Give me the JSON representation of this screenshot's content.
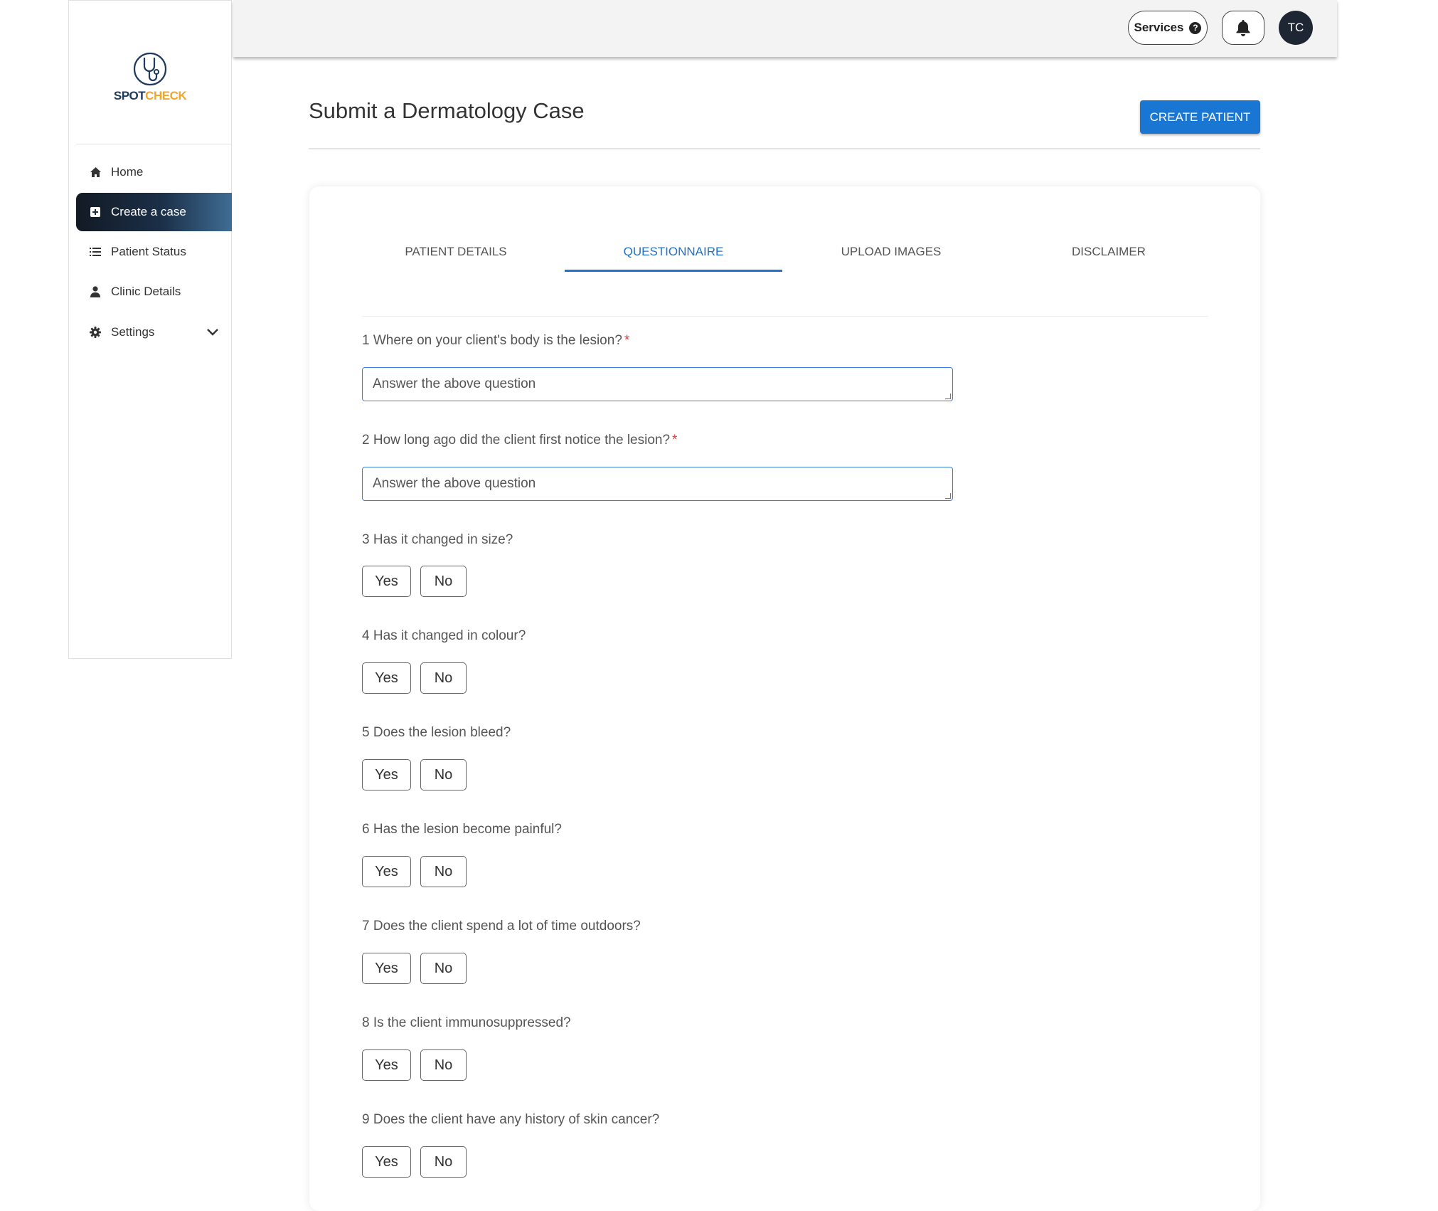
{
  "brand": {
    "name_part1": "SPOT",
    "name_part2": "CHECK",
    "color_primary": "#1f3a5c",
    "color_accent": "#f5a623"
  },
  "sidebar": {
    "items": [
      {
        "label": "Home",
        "icon": "home-icon"
      },
      {
        "label": "Create a case",
        "icon": "plus-square-icon",
        "active": true
      },
      {
        "label": "Patient Status",
        "icon": "list-icon"
      },
      {
        "label": "Clinic Details",
        "icon": "user-icon"
      },
      {
        "label": "Settings",
        "icon": "gear-icon",
        "expandable": true
      }
    ]
  },
  "topbar": {
    "services_label": "Services",
    "services_help_glyph": "?",
    "avatar_initials": "TC"
  },
  "header": {
    "title": "Submit a Dermatology Case",
    "create_patient_label": "CREATE PATIENT",
    "accent": "#1976d2"
  },
  "tabs": [
    {
      "label": "PATIENT DETAILS"
    },
    {
      "label": "QUESTIONNAIRE",
      "active": true
    },
    {
      "label": "UPLOAD IMAGES"
    },
    {
      "label": "DISCLAIMER"
    }
  ],
  "questions": [
    {
      "text": "1 Where on your client's body is the lesion?",
      "required": "*",
      "type": "text",
      "placeholder": "Answer the above question"
    },
    {
      "text": "2 How long ago did the client first notice the lesion?",
      "required": "*",
      "type": "text",
      "placeholder": "Answer the above question"
    },
    {
      "text": "3 Has it changed in size?",
      "type": "yesno"
    },
    {
      "text": "4 Has it changed in colour?",
      "type": "yesno"
    },
    {
      "text": "5 Does the lesion bleed?",
      "type": "yesno"
    },
    {
      "text": "6 Has the lesion become painful?",
      "type": "yesno"
    },
    {
      "text": "7 Does the client spend a lot of time outdoors?",
      "type": "yesno"
    },
    {
      "text": "8 Is the client immunosuppressed?",
      "type": "yesno"
    },
    {
      "text": "9 Does the client have any history of skin cancer?",
      "type": "yesno"
    }
  ],
  "yesno": {
    "yes_label": "Yes",
    "no_label": "No"
  }
}
